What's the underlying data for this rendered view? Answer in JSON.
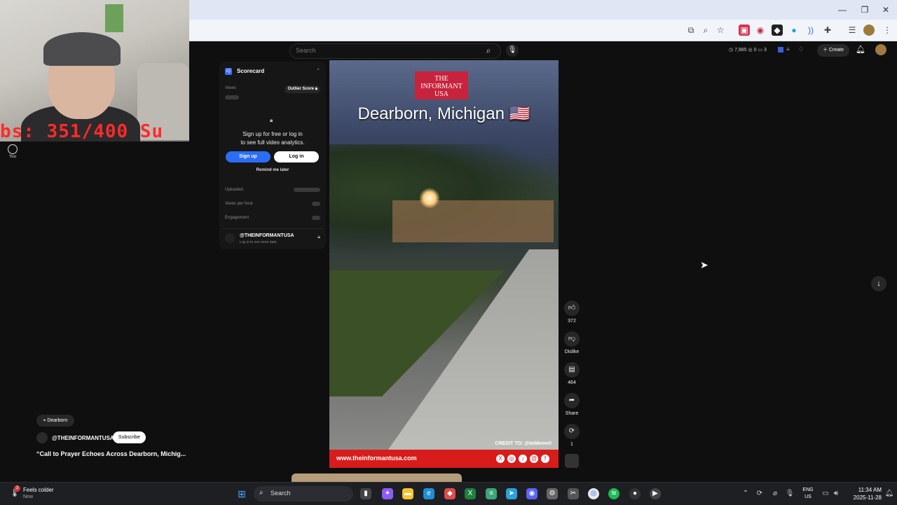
{
  "webcam": {
    "overlay_text": "bs: 351/400  Su"
  },
  "browser": {
    "window_buttons": {
      "minimize": "—",
      "restore": "❐",
      "close": "✕"
    }
  },
  "yt": {
    "you_label": "You",
    "search_placeholder": "Search",
    "stats": {
      "views": "7,985",
      "a": "0",
      "b": "3"
    },
    "create_label": "Create"
  },
  "scorecard": {
    "title": "Scorecard",
    "views_label": "Views",
    "outlier_label": "Outlier Score",
    "prompt_line1": "Sign up for free or log in",
    "prompt_line2": "to see full video analytics.",
    "signup_label": "Sign up",
    "login_label": "Log in",
    "remind_label": "Remind me later",
    "uploaded_label": "Uploaded",
    "views_per_hour_label": "Views per hour",
    "engagement_label": "Engagement",
    "channel_name": "@THEINFORMANTUSA",
    "channel_sub": "Log in to see more data"
  },
  "video": {
    "logo_text": "THE INFORMANT USA",
    "title": "Dearborn, Michigan 🇺🇸",
    "credit": "CREDIT TO: @ImMeme0",
    "url": "www.theinformantusa.com"
  },
  "actions": {
    "likes": "372",
    "dislike_label": "Dislike",
    "comments": "464",
    "share_label": "Share",
    "remix": "1"
  },
  "short_info": {
    "location": "Dearborn",
    "channel": "@THEINFORMANTUSA",
    "subscribe_label": "Subscribe",
    "title": "“Call to Prayer Echoes Across Dearborn, Michig..."
  },
  "taskbar": {
    "weather_title": "Feels colder",
    "weather_sub": "Now",
    "weather_badge": "3",
    "search_label": "Search",
    "lang": "ENG",
    "region": "US",
    "time": "11:34 AM",
    "date": "2025-11-28"
  }
}
